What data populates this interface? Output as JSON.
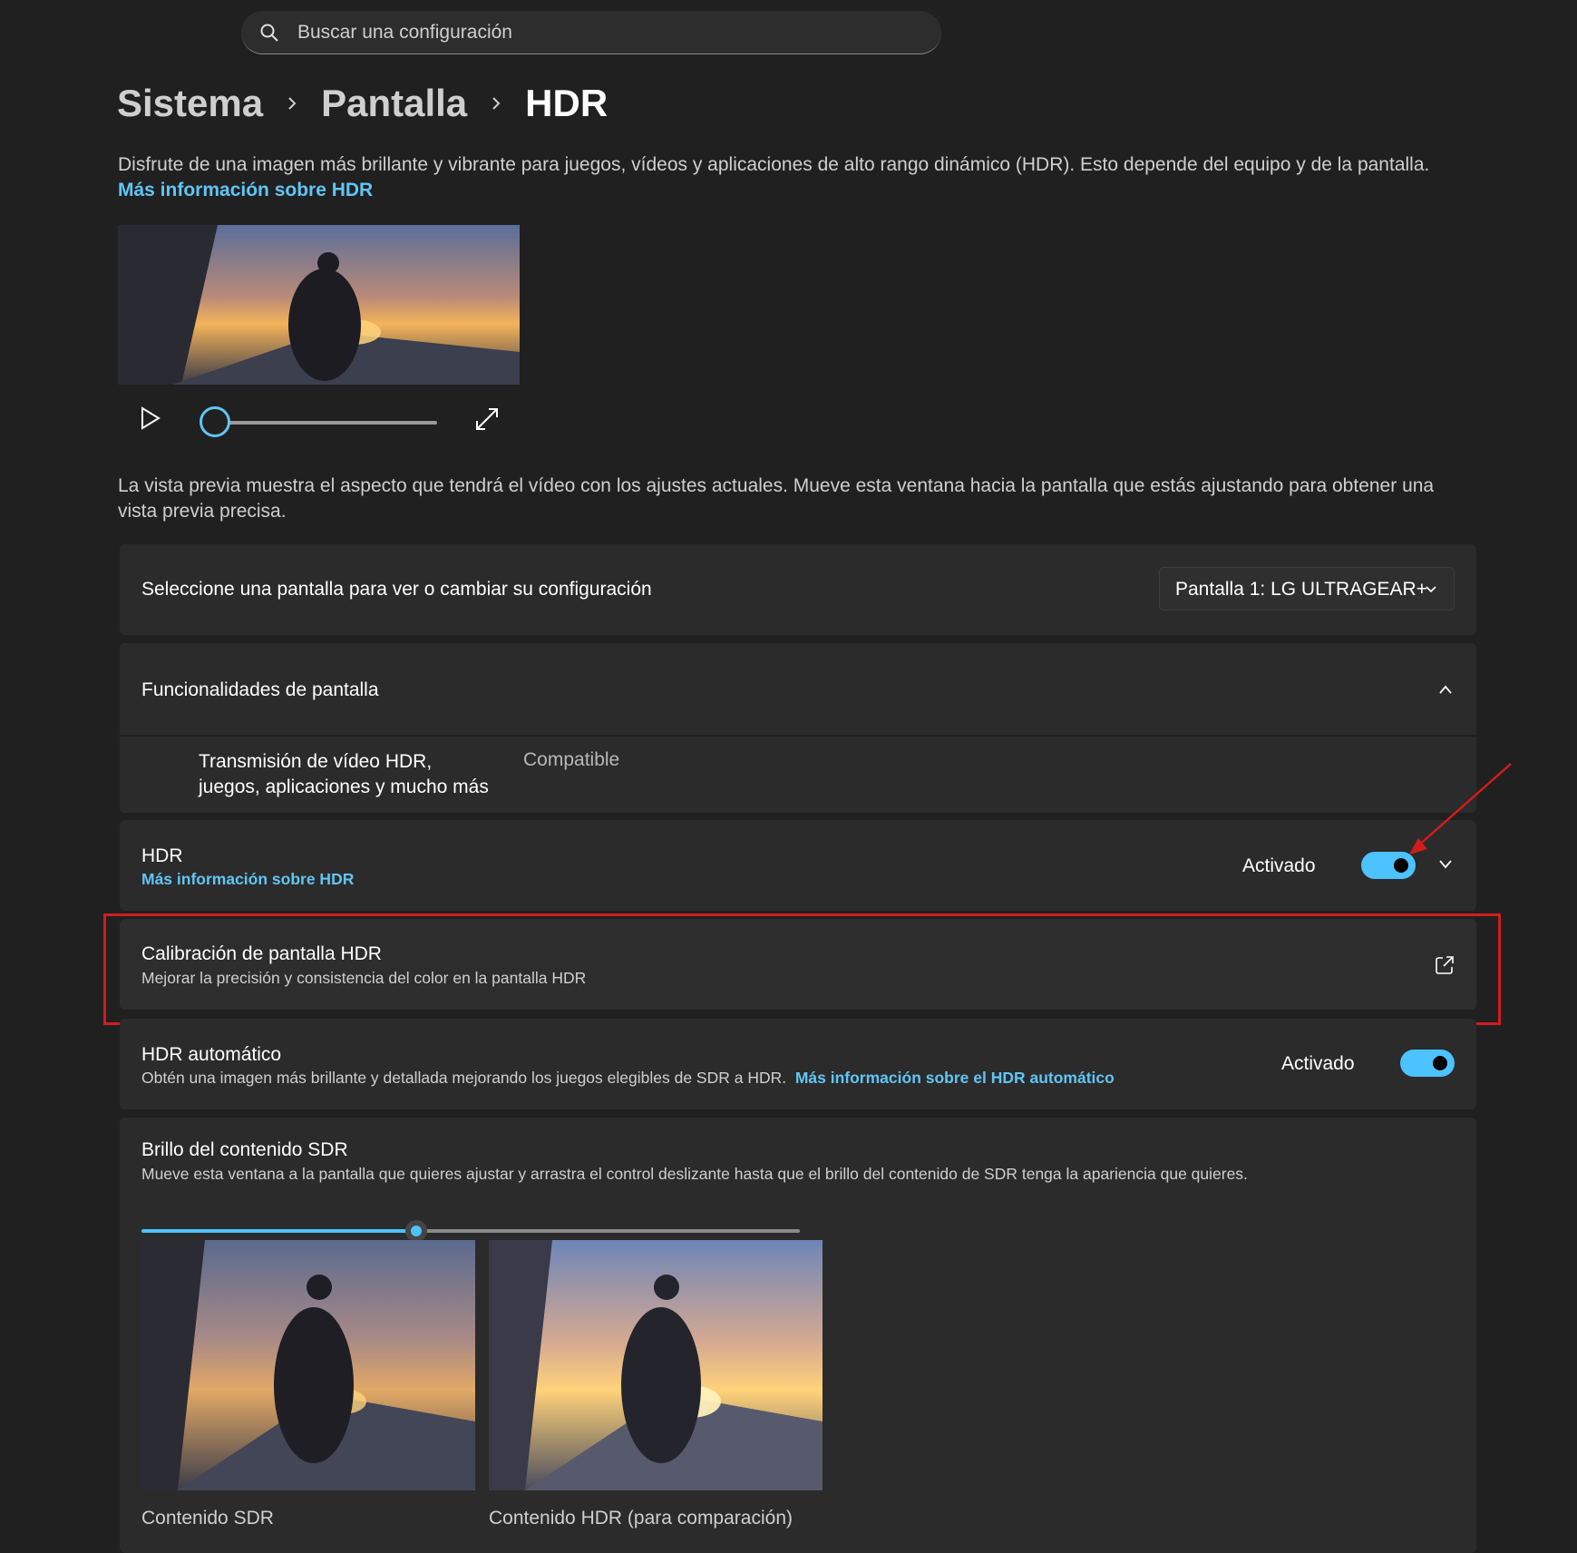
{
  "search": {
    "placeholder": "Buscar una configuración"
  },
  "breadcrumb": {
    "items": [
      "Sistema",
      "Pantalla",
      "HDR"
    ]
  },
  "intro": {
    "text": "Disfrute de una imagen más brillante y vibrante para juegos, vídeos y aplicaciones de alto rango dinámico (HDR). Esto depende del equipo y de la pantalla. ",
    "link": "Más información sobre HDR"
  },
  "preview_note": "La vista previa muestra el aspecto que tendrá el vídeo con los ajustes actuales. Mueve esta ventana hacia la pantalla que estás ajustando para obtener una vista previa precisa.",
  "display_select": {
    "label": "Seleccione una pantalla para ver o cambiar su configuración",
    "value": "Pantalla 1: LG ULTRAGEAR+"
  },
  "capabilities": {
    "title": "Funcionalidades de pantalla",
    "item_label": "Transmisión de vídeo HDR, juegos, aplicaciones y mucho más",
    "item_value": "Compatible"
  },
  "hdr": {
    "title": "HDR",
    "link": "Más información sobre HDR",
    "state": "Activado",
    "on": true
  },
  "calibration": {
    "title": "Calibración de pantalla HDR",
    "subtitle": "Mejorar la precisión y consistencia del color en la pantalla HDR"
  },
  "auto_hdr": {
    "title": "HDR automático",
    "subtitle": "Obtén una imagen más brillante y detallada mejorando los juegos elegibles de SDR a HDR.",
    "link": "Más información sobre el HDR automático",
    "state": "Activado",
    "on": true
  },
  "sdr_brightness": {
    "title": "Brillo del contenido SDR",
    "subtitle": "Mueve esta ventana a la pantalla que quieres ajustar y arrastra el control deslizante hasta que el brillo del contenido de SDR tenga la apariencia que quieres.",
    "value_fraction": 0.4,
    "caption_sdr": "Contenido SDR",
    "caption_hdr": "Contenido HDR (para comparación)"
  },
  "colors": {
    "accent": "#4cc2ff",
    "link": "#61c5f4",
    "highlight": "#d21c1c",
    "background": "#202020",
    "card": "#2b2b2b"
  },
  "icons": [
    "search-icon",
    "chevron-right-icon",
    "play-icon",
    "expand-icon",
    "chevron-down-icon",
    "chevron-up-icon",
    "open-external-icon",
    "arrow-annotation-icon"
  ]
}
